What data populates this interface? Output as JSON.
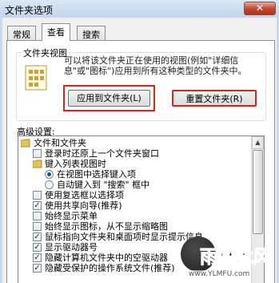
{
  "window": {
    "title": "文件夹选项",
    "close_glyph": "✕"
  },
  "tabs": [
    {
      "label": "常规",
      "active": false
    },
    {
      "label": "查看",
      "active": true
    },
    {
      "label": "搜索",
      "active": false
    }
  ],
  "folder_views": {
    "group_title": "文件夹视图",
    "description": "可以将该文件夹正在使用的视图(例如\"详细信息\"或\"图标\")应用到所有这种类型的文件夹中。",
    "apply_button": "应用到文件夹(L)",
    "reset_button": "重置文件夹(R)",
    "highlight_color": "#e22020"
  },
  "advanced": {
    "label": "高级设置:",
    "items": [
      {
        "text": "文件和文件夹",
        "kind": "folder"
      },
      {
        "text": "登录时还原上一个文件夹窗口",
        "kind": "checkbox",
        "checked": false
      },
      {
        "text": "键入列表视图时",
        "kind": "folder"
      },
      {
        "text": "在视图中选择键入项",
        "kind": "radio",
        "checked": true
      },
      {
        "text": "自动键入到 \"搜索\" 框中",
        "kind": "radio",
        "checked": false
      },
      {
        "text": "使用复选框以选择项",
        "kind": "checkbox",
        "checked": false
      },
      {
        "text": "使用共享向导(推荐)",
        "kind": "checkbox",
        "checked": true
      },
      {
        "text": "始终显示菜单",
        "kind": "checkbox",
        "checked": false
      },
      {
        "text": "始终显示图标，从不显示缩略图",
        "kind": "checkbox",
        "checked": false
      },
      {
        "text": "鼠标指向文件夹和桌面项时显示提示信息",
        "kind": "checkbox",
        "checked": true
      },
      {
        "text": "显示驱动器号",
        "kind": "checkbox",
        "checked": true
      },
      {
        "text": "隐藏计算机文件夹中的空驱动器",
        "kind": "checkbox",
        "checked": true
      },
      {
        "text": "隐藏受保护的操作系统文件(推荐)",
        "kind": "checkbox",
        "checked": true
      }
    ]
  },
  "watermark": {
    "text": "雨林木风",
    "url": "www.YLMFU.com"
  },
  "colors": {
    "window_frame": "#c9d9ee",
    "checkmark": "#1d3a6b"
  }
}
